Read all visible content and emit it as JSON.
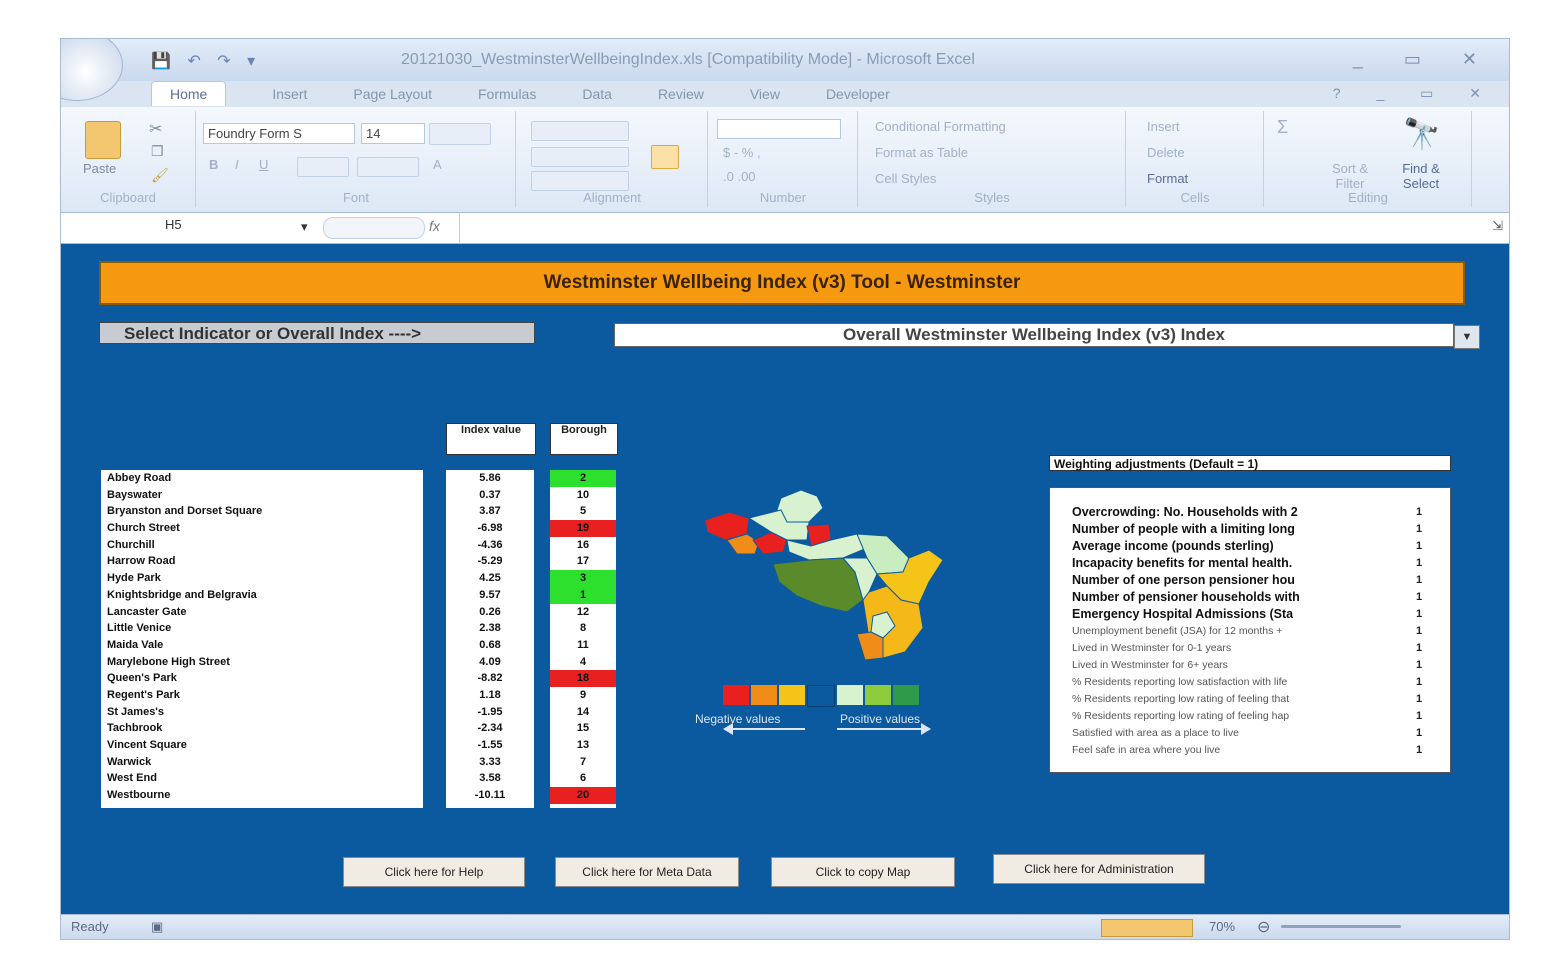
{
  "window": {
    "title": "20121030_WestminsterWellbeingIndex.xls  [Compatibility Mode] - Microsoft Excel",
    "controls": "_ ▭ ✕"
  },
  "ribbon": {
    "tabs": [
      "Home",
      "Insert",
      "Page Layout",
      "Formulas",
      "Data",
      "Review",
      "View",
      "Developer"
    ],
    "groups": {
      "clipboard": "Clipboard",
      "font": "Font",
      "alignment": "Alignment",
      "number": "Number",
      "styles": "Styles",
      "cells": "Cells",
      "editing": "Editing"
    },
    "paste_label": "Paste",
    "font_name": "Foundry Form S",
    "font_size": "14",
    "styles_items": [
      "Conditional Formatting",
      "Format as Table",
      "Cell Styles"
    ],
    "cells_items": [
      "Insert",
      "Delete",
      "Format"
    ],
    "editing_items": [
      "Sort & Filter",
      "Find & Select"
    ]
  },
  "formula_bar": {
    "name_box": "H5",
    "fx": "fx"
  },
  "sheet": {
    "banner": "Westminster Wellbeing Index (v3) Tool - Westminster",
    "select_label": "Select Indicator or Overall Index ---->",
    "dropdown_value": "Overall Westminster Wellbeing Index (v3) Index",
    "col_index": "Index value",
    "col_borough": "Borough",
    "wards": [
      {
        "name": "Abbey Road",
        "value": "5.86",
        "rank": "2",
        "color": "#2ee02e"
      },
      {
        "name": "Bayswater",
        "value": "0.37",
        "rank": "10",
        "color": "#ffffff"
      },
      {
        "name": "Bryanston and Dorset Square",
        "value": "3.87",
        "rank": "5",
        "color": "#ffffff"
      },
      {
        "name": "Church Street",
        "value": "-6.98",
        "rank": "19",
        "color": "#e82020"
      },
      {
        "name": "Churchill",
        "value": "-4.36",
        "rank": "16",
        "color": "#ffffff"
      },
      {
        "name": "Harrow Road",
        "value": "-5.29",
        "rank": "17",
        "color": "#ffffff"
      },
      {
        "name": "Hyde Park",
        "value": "4.25",
        "rank": "3",
        "color": "#2ee02e"
      },
      {
        "name": "Knightsbridge and Belgravia",
        "value": "9.57",
        "rank": "1",
        "color": "#2ee02e"
      },
      {
        "name": "Lancaster Gate",
        "value": "0.26",
        "rank": "12",
        "color": "#ffffff"
      },
      {
        "name": "Little Venice",
        "value": "2.38",
        "rank": "8",
        "color": "#ffffff"
      },
      {
        "name": "Maida Vale",
        "value": "0.68",
        "rank": "11",
        "color": "#ffffff"
      },
      {
        "name": "Marylebone High Street",
        "value": "4.09",
        "rank": "4",
        "color": "#ffffff"
      },
      {
        "name": "Queen's Park",
        "value": "-8.82",
        "rank": "18",
        "color": "#e82020"
      },
      {
        "name": "Regent's Park",
        "value": "1.18",
        "rank": "9",
        "color": "#ffffff"
      },
      {
        "name": "St James's",
        "value": "-1.95",
        "rank": "14",
        "color": "#ffffff"
      },
      {
        "name": "Tachbrook",
        "value": "-2.34",
        "rank": "15",
        "color": "#ffffff"
      },
      {
        "name": "Vincent Square",
        "value": "-1.55",
        "rank": "13",
        "color": "#ffffff"
      },
      {
        "name": "Warwick",
        "value": "3.33",
        "rank": "7",
        "color": "#ffffff"
      },
      {
        "name": "West End",
        "value": "3.58",
        "rank": "6",
        "color": "#ffffff"
      },
      {
        "name": "Westbourne",
        "value": "-10.11",
        "rank": "20",
        "color": "#e82020"
      }
    ],
    "legend_colors": [
      "#e8201e",
      "#f08c18",
      "#f4c418",
      "#0b5aa0",
      "#d8f2d0",
      "#8ccc3c",
      "#2e9a4a"
    ],
    "legend_negative": "Negative values",
    "legend_positive": "Positive values",
    "weighting_title": "Weighting adjustments (Default = 1)",
    "weighting": [
      {
        "name": "Overcrowding: No. Households with 2",
        "value": "1",
        "style": "bold"
      },
      {
        "name": "Number of people with a limiting long",
        "value": "1",
        "style": "bold"
      },
      {
        "name": "Average income (pounds sterling)",
        "value": "1",
        "style": "bold"
      },
      {
        "name": "Incapacity benefits for mental health.",
        "value": "1",
        "style": "bold"
      },
      {
        "name": "Number of one person pensioner hou",
        "value": "1",
        "style": "bold"
      },
      {
        "name": "Number of pensioner households with",
        "value": "1",
        "style": "bold"
      },
      {
        "name": "Emergency Hospital Admissions (Sta",
        "value": "1",
        "style": "bold"
      },
      {
        "name": "Unemployment benefit (JSA) for 12 months +",
        "value": "1",
        "style": "light"
      },
      {
        "name": "Lived in Westminster for 0-1 years",
        "value": "1",
        "style": "light"
      },
      {
        "name": "Lived in Westminster for 6+ years",
        "value": "1",
        "style": "light"
      },
      {
        "name": "% Residents reporting low satisfaction with life",
        "value": "1",
        "style": "light"
      },
      {
        "name": "% Residents reporting low rating of feeling that",
        "value": "1",
        "style": "light"
      },
      {
        "name": "% Residents reporting low rating of feeling hap",
        "value": "1",
        "style": "light"
      },
      {
        "name": "Satisfied with area as a place to live",
        "value": "1",
        "style": "light"
      },
      {
        "name": "Feel safe in area where you live",
        "value": "1",
        "style": "light"
      }
    ],
    "buttons": {
      "help": "Click here for Help",
      "meta": "Click here for Meta Data",
      "copy_map": "Click to copy Map",
      "admin": "Click here for Administration"
    }
  },
  "status": {
    "ready": "Ready",
    "zoom": "70%"
  }
}
